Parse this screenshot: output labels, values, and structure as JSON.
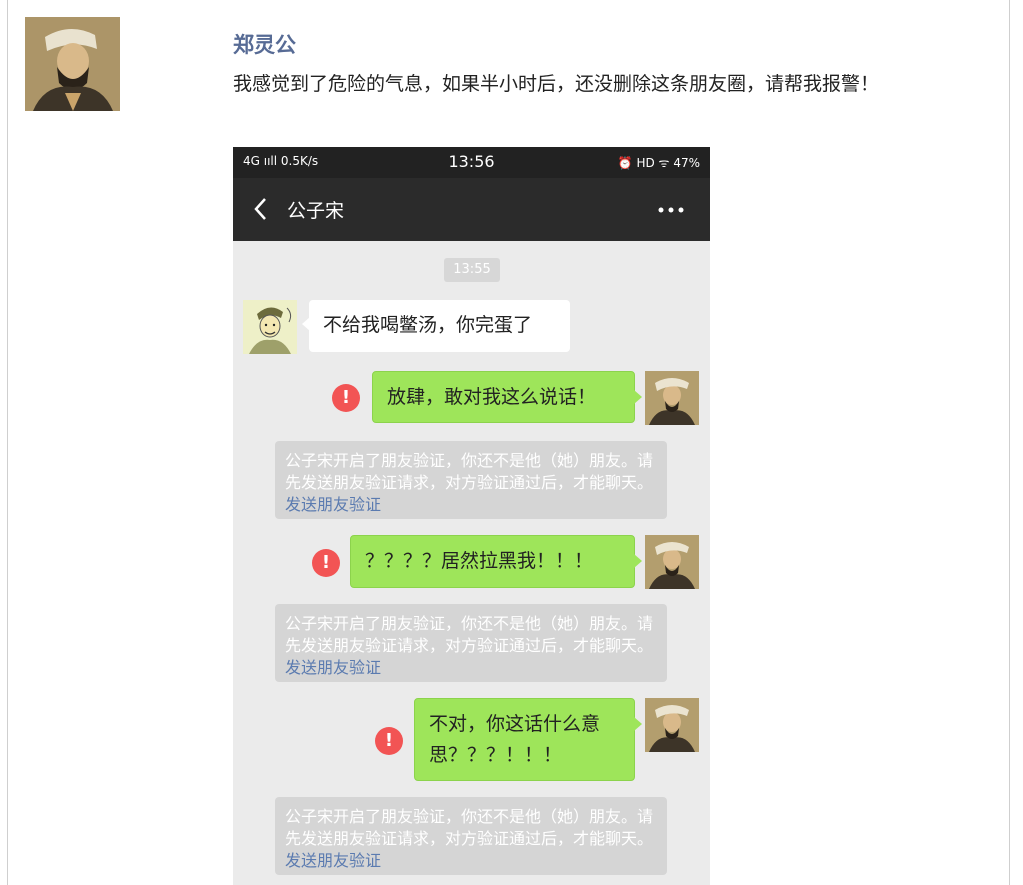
{
  "post": {
    "author": "郑灵公",
    "text": "我感觉到了危险的气息，如果半小时后，还没删除这条朋友圈，请帮我报警！"
  },
  "status_bar": {
    "left": "4G ııll 0.5K/s",
    "time": "13:56",
    "right": "⏰ HD ᯤ 47%"
  },
  "chat": {
    "title": "公子宋",
    "time_label": "13:55",
    "messages": [
      {
        "side": "left",
        "text": "不给我喝鳖汤，你完蛋了"
      },
      {
        "side": "right",
        "text": "放肆，敢对我这么说话！",
        "failed": true
      },
      {
        "side": "right",
        "text": "？？？？居然拉黑我！！！",
        "failed": true
      },
      {
        "side": "right",
        "text": "不对，你这话什么意思？？？！！！",
        "failed": true
      }
    ],
    "system_notice": {
      "text": "公子宋开启了朋友验证，你还不是他（她）朋友。请先发送朋友验证请求，对方验证通过后，才能聊天。",
      "link": "发送朋友验证"
    },
    "error_glyph": "!"
  },
  "colors": {
    "name_blue": "#576b95",
    "bubble_green": "#9ee55a",
    "error_red": "#f25454",
    "chat_bg": "#ebebeb",
    "topbar": "#2b2b2b"
  }
}
